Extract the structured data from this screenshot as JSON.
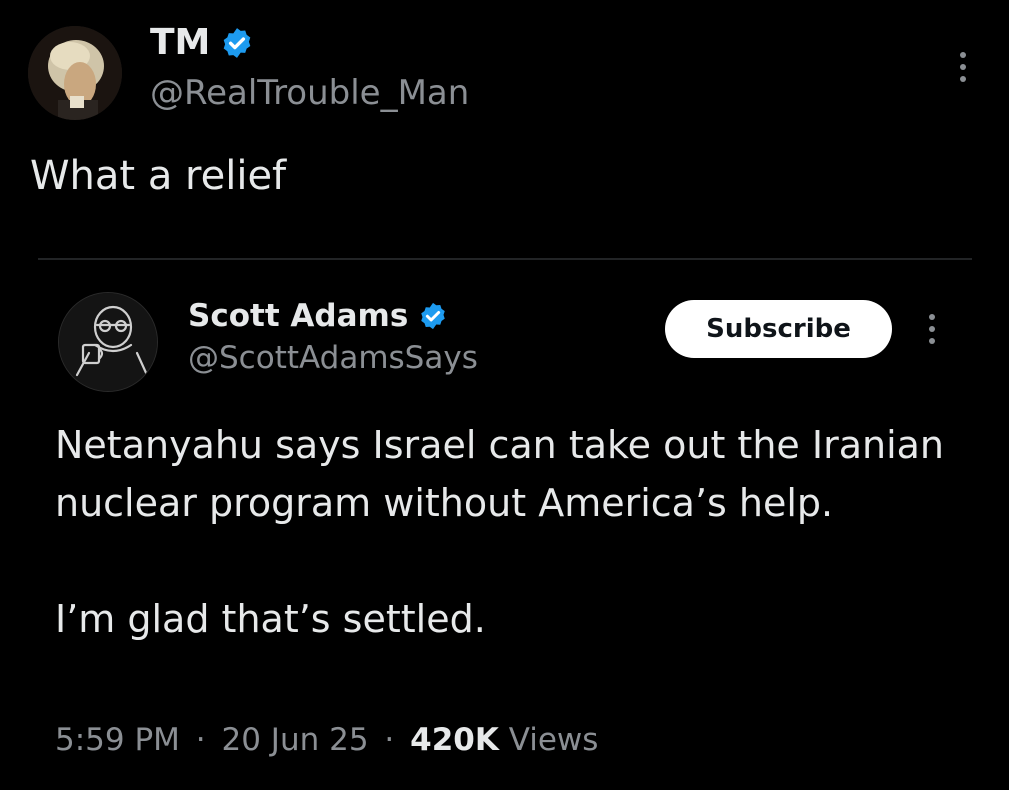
{
  "post": {
    "author": {
      "display_name": "TM",
      "handle": "@RealTrouble_Man",
      "verified_icon": "verified-badge-icon",
      "avatar_icon": "portrait-avatar"
    },
    "text": "What a relief",
    "more_icon": "more-vertical-icon"
  },
  "quoted_post": {
    "author": {
      "display_name": "Scott Adams",
      "handle": "@ScottAdamsSays",
      "verified_icon": "verified-badge-icon",
      "avatar_icon": "line-drawing-avatar"
    },
    "subscribe_label": "Subscribe",
    "more_icon": "more-vertical-icon",
    "paragraphs": [
      "Netanyahu says Israel can take out the Iranian nuclear program without America’s help.",
      "I’m glad that’s settled."
    ],
    "meta": {
      "time": "5:59 PM",
      "separator": "·",
      "date": "20 Jun 25",
      "views_count": "420K",
      "views_label": "Views"
    }
  },
  "colors": {
    "background": "#000000",
    "text_primary": "#e7e9ea",
    "text_secondary": "#8b8f94",
    "verified_blue": "#1d9bf0",
    "button_bg": "#ffffff",
    "divider": "#222426"
  }
}
